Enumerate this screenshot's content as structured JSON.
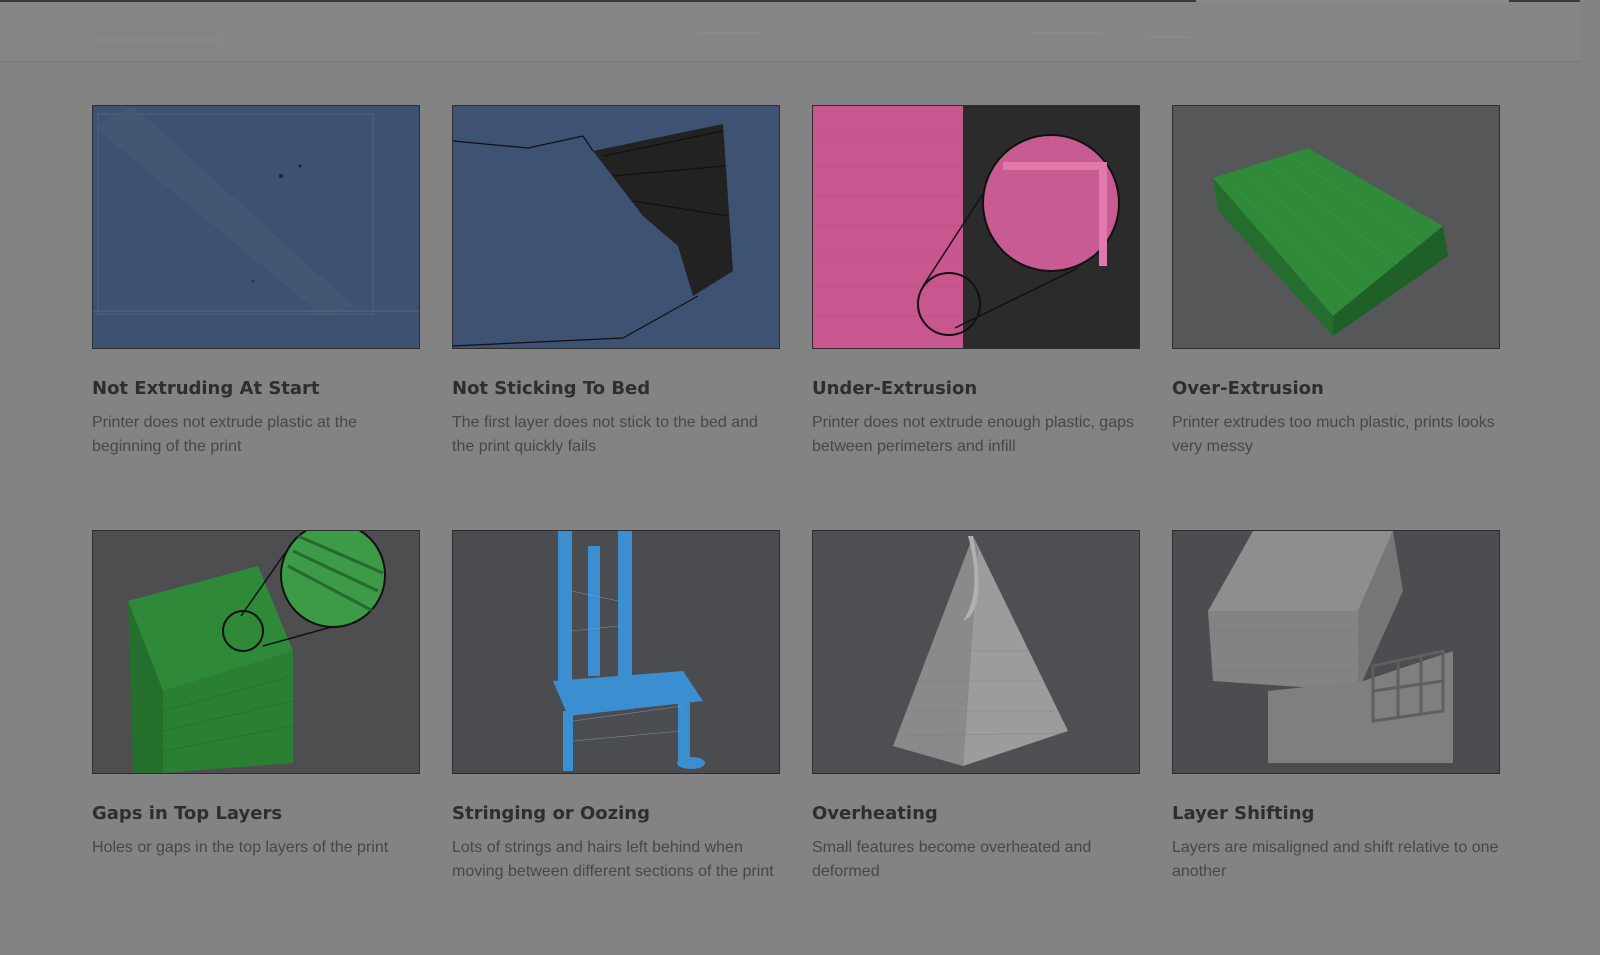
{
  "cards": [
    {
      "title": "Not Extruding At Start",
      "description": "Printer does not extrude plastic at the beginning of the print",
      "image": "blue-tape-bed-photo"
    },
    {
      "title": "Not Sticking To Bed",
      "description": "The first layer does not stick to the bed and the print quickly fails",
      "image": "failed-print-on-bed-photo"
    },
    {
      "title": "Under-Extrusion",
      "description": "Printer does not extrude enough plastic, gaps between perimeters and infill",
      "image": "pink-print-magnified-photo"
    },
    {
      "title": "Over-Extrusion",
      "description": "Printer extrudes too much plastic, prints looks very messy",
      "image": "green-messy-print-photo"
    },
    {
      "title": "Gaps in Top Layers",
      "description": "Holes or gaps in the top layers of the print",
      "image": "green-cube-magnified-photo"
    },
    {
      "title": "Stringing or Oozing",
      "description": "Lots of strings and hairs left behind when moving between different sections of the print",
      "image": "blue-chair-print-photo"
    },
    {
      "title": "Overheating",
      "description": "Small features become overheated and deformed",
      "image": "gray-pyramid-print-photo"
    },
    {
      "title": "Layer Shifting",
      "description": "Layers are misaligned and shift relative to one another",
      "image": "gray-shifted-block-photo"
    }
  ],
  "colors": {
    "overlay_dim": "#838383",
    "title_text": "#2e2e2e",
    "description_text": "#474747"
  }
}
